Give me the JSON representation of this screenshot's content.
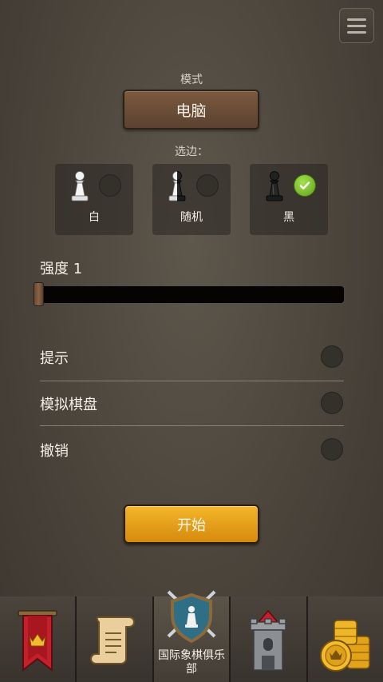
{
  "header": {
    "menu_icon": "hamburger-menu-icon"
  },
  "mode": {
    "label": "模式",
    "value": "电脑"
  },
  "side": {
    "label": "选边：",
    "options": [
      {
        "name": "白",
        "icon": "white-pawn-icon",
        "selected": false
      },
      {
        "name": "随机",
        "icon": "random-pawn-icon",
        "selected": false
      },
      {
        "name": "黑",
        "icon": "black-pawn-icon",
        "selected": true
      }
    ]
  },
  "strength": {
    "label": "强度 1",
    "level": 1
  },
  "options": [
    {
      "label": "提示",
      "enabled": false
    },
    {
      "label": "模拟棋盘",
      "enabled": false
    },
    {
      "label": "撤销",
      "enabled": false
    }
  ],
  "start": {
    "label": "开始"
  },
  "bottom_nav": [
    {
      "icon": "banner-crown-icon",
      "label": ""
    },
    {
      "icon": "scroll-icon",
      "label": ""
    },
    {
      "icon": "shield-swords-icon",
      "label": "国际象棋俱乐部",
      "active": true
    },
    {
      "icon": "castle-tower-icon",
      "label": ""
    },
    {
      "icon": "gold-coins-icon",
      "label": ""
    }
  ],
  "colors": {
    "accent_gold": "#e9a41d",
    "check_green": "#7cc52f",
    "mode_brown": "#6b4e37",
    "banner_red": "#c4202a"
  }
}
